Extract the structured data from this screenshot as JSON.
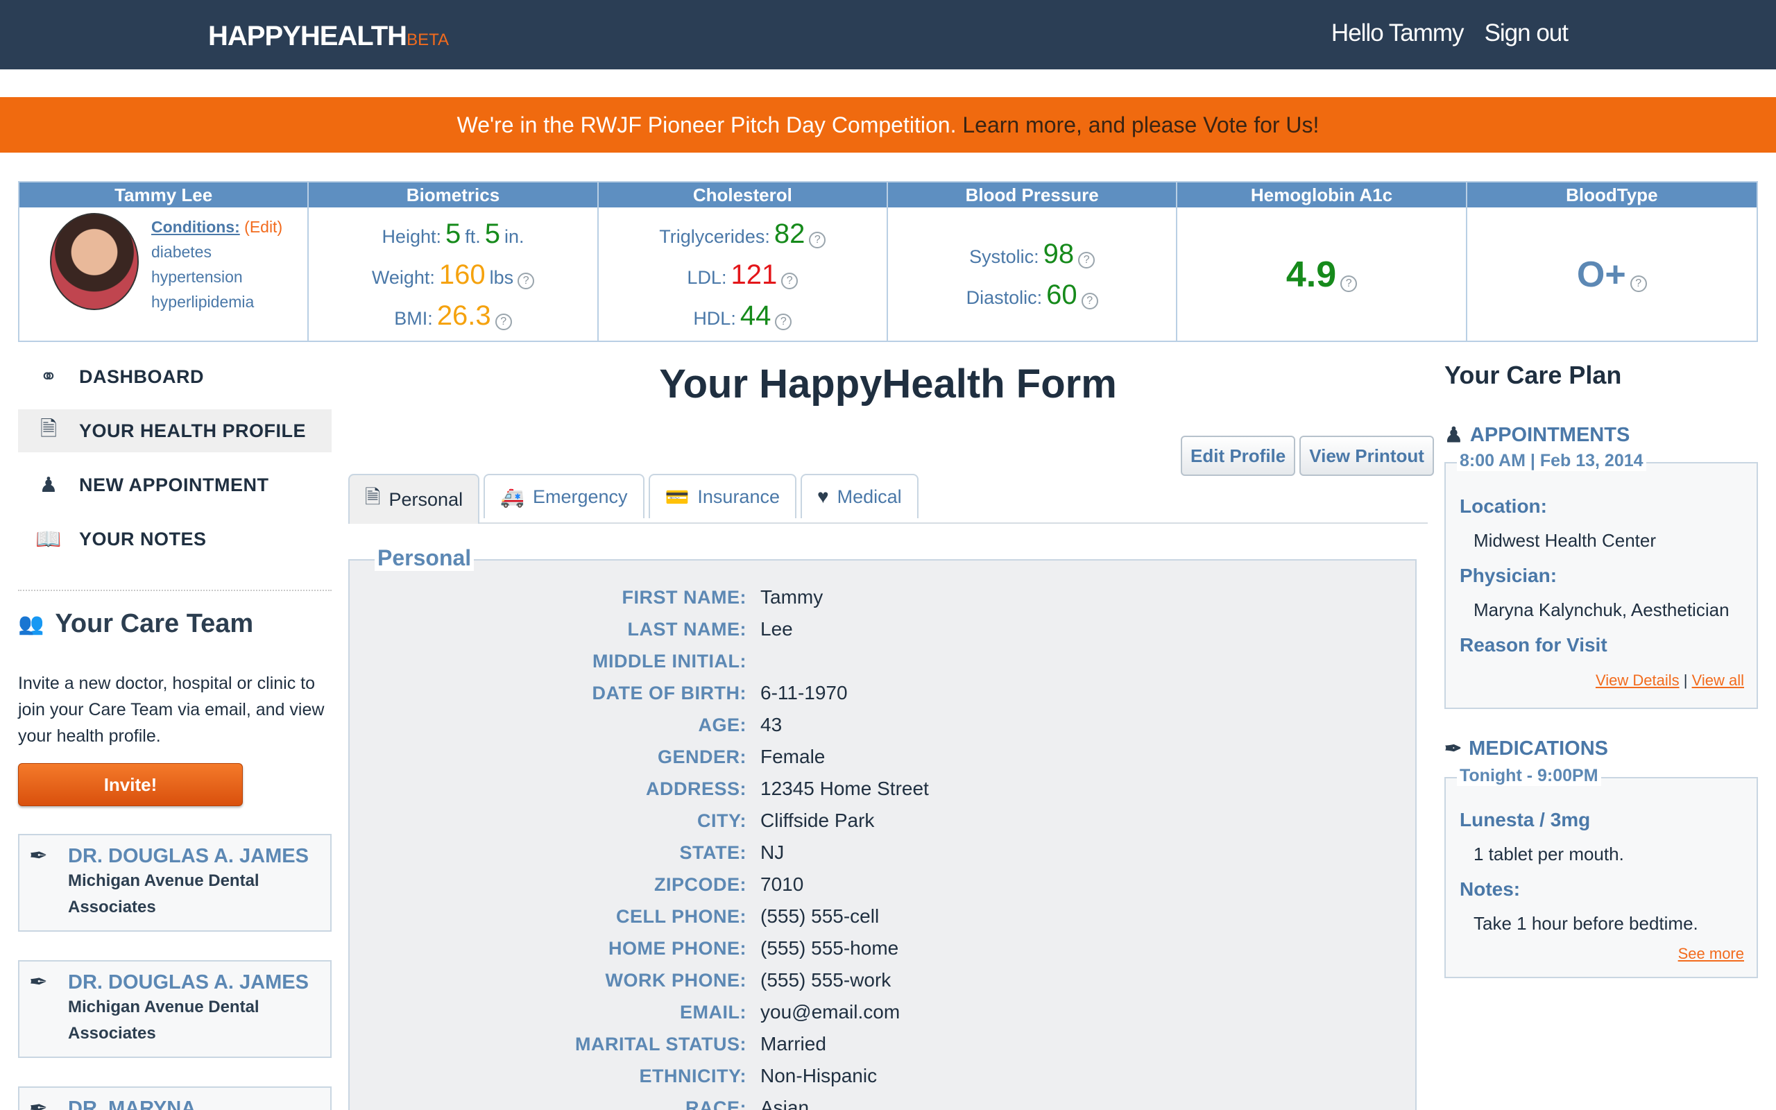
{
  "header": {
    "logo": "HAPPYHEALTH",
    "logo_tag": "BETA",
    "greeting": "Hello Tammy",
    "signout": "Sign out"
  },
  "banner": {
    "text1": "We're in the RWJF Pioneer Pitch Day Competition.",
    "text2": "Learn more, and please",
    "link": "Vote for Us!"
  },
  "stats": {
    "patient": {
      "name": "Tammy Lee",
      "conditions_label": "Conditions:",
      "edit_label": "Edit",
      "conditions": [
        "diabetes",
        "hypertension",
        "hyperlipidemia"
      ]
    },
    "biometrics": {
      "title": "Biometrics",
      "height_label": "Height:",
      "height_ft": "5",
      "ft_unit": "ft.",
      "height_in": "5",
      "in_unit": "in.",
      "weight_label": "Weight:",
      "weight": "160",
      "weight_unit": "lbs",
      "bmi_label": "BMI:",
      "bmi": "26.3"
    },
    "cholesterol": {
      "title": "Cholesterol",
      "trig_label": "Triglycerides:",
      "trig": "82",
      "ldl_label": "LDL:",
      "ldl": "121",
      "hdl_label": "HDL:",
      "hdl": "44"
    },
    "blood_pressure": {
      "title": "Blood Pressure",
      "systolic_label": "Systolic:",
      "systolic": "98",
      "diastolic_label": "Diastolic:",
      "diastolic": "60"
    },
    "a1c": {
      "title": "Hemoglobin A1c",
      "value": "4.9"
    },
    "bloodtype": {
      "title": "BloodType",
      "value": "O+"
    },
    "help_glyph": "?"
  },
  "sidebar": {
    "items": [
      {
        "label": "DASHBOARD",
        "icon": "dashboard-icon"
      },
      {
        "label": "YOUR HEALTH PROFILE",
        "icon": "profile-icon"
      },
      {
        "label": "NEW APPOINTMENT",
        "icon": "doctor-icon"
      },
      {
        "label": "YOUR NOTES",
        "icon": "notes-icon"
      }
    ],
    "careteam_title": "Your Care Team",
    "careteam_desc": "Invite a new doctor, hospital or clinic to join your Care Team via email, and view your health profile.",
    "invite_label": "Invite!",
    "doctors": [
      {
        "name": "DR. DOUGLAS A. JAMES",
        "place": "Michigan Avenue Dental Associates"
      },
      {
        "name": "DR. DOUGLAS A. JAMES",
        "place": "Michigan Avenue Dental Associates"
      },
      {
        "name": "DR. MARYNA KALYNCHUK",
        "place": ""
      }
    ]
  },
  "form": {
    "title": "Your HappyHealth Form",
    "edit_profile": "Edit Profile",
    "view_printout": "View Printout",
    "tabs": [
      "Personal",
      "Emergency",
      "Insurance",
      "Medical"
    ],
    "section": "Personal",
    "fields": [
      {
        "label": "FIRST NAME:",
        "value": "Tammy"
      },
      {
        "label": "LAST NAME:",
        "value": "Lee"
      },
      {
        "label": "MIDDLE INITIAL:",
        "value": ""
      },
      {
        "label": "DATE OF BIRTH:",
        "value": "6-11-1970"
      },
      {
        "label": "AGE:",
        "value": "43"
      },
      {
        "label": "GENDER:",
        "value": "Female"
      },
      {
        "label": "ADDRESS:",
        "value": "12345 Home Street"
      },
      {
        "label": "CITY:",
        "value": "Cliffside Park"
      },
      {
        "label": "STATE:",
        "value": "NJ"
      },
      {
        "label": "ZIPCODE:",
        "value": "7010"
      },
      {
        "label": "CELL PHONE:",
        "value": "(555) 555-cell"
      },
      {
        "label": "HOME PHONE:",
        "value": "(555) 555-home"
      },
      {
        "label": "WORK PHONE:",
        "value": "(555) 555-work"
      },
      {
        "label": "EMAIL:",
        "value": "you@email.com"
      },
      {
        "label": "MARITAL STATUS:",
        "value": "Married"
      },
      {
        "label": "ETHNICITY:",
        "value": "Non-Hispanic"
      },
      {
        "label": "RACE:",
        "value": "Asian"
      }
    ]
  },
  "careplan": {
    "title": "Your Care Plan",
    "appointments": {
      "title": "APPOINTMENTS",
      "when": "8:00 AM | Feb 13, 2014",
      "location_label": "Location:",
      "location": "Midwest Health Center",
      "physician_label": "Physician:",
      "physician": "Maryna Kalynchuk, Aesthetician",
      "reason_label": "Reason for Visit",
      "view_details": "View Details",
      "separator": "|",
      "view_all": "View all"
    },
    "medications": {
      "title": "MEDICATIONS",
      "when": "Tonight - 9:00PM",
      "drug": "Lunesta / 3mg",
      "dosage": "1 tablet per mouth.",
      "notes_label": "Notes:",
      "notes": "Take 1 hour before bedtime.",
      "see_more": "See more"
    }
  }
}
